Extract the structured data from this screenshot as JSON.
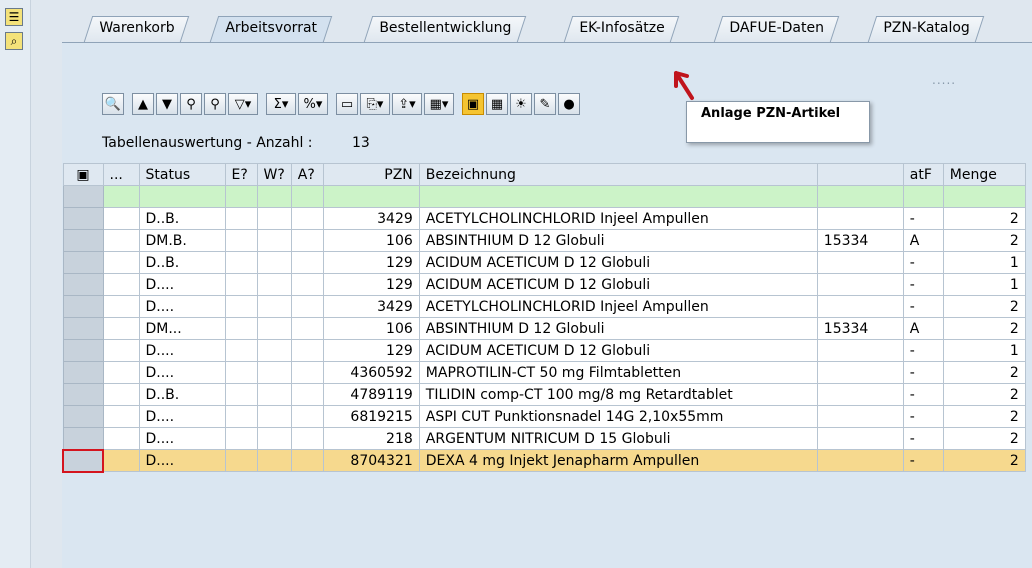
{
  "tabs": [
    "Warenkorb",
    "Arbeitsvorrat",
    "Bestellentwicklung",
    "EK-Infosätze",
    "DAFUE-Daten",
    "PZN-Katalog"
  ],
  "active_tab": "Arbeitsvorrat",
  "toolbar_more": ".....",
  "table_title": "Tabellenauswertung - Anzahl :",
  "table_count": "13",
  "tooltip": "Anlage PZN-Artikel",
  "columns": [
    "...",
    "Status",
    "E?",
    "W?",
    "A?",
    "PZN",
    "Bezeichnung",
    "",
    "atF",
    "Menge"
  ],
  "rows": [
    {
      "status": "D..B.",
      "pzn": "3429",
      "bez": "ACETYLCHOLINCHLORID Injeel Ampullen",
      "col8": "",
      "atf": "-",
      "menge": "2"
    },
    {
      "status": "DM.B.",
      "pzn": "106",
      "bez": "ABSINTHIUM D 12 Globuli",
      "col8": "15334",
      "atf": "A",
      "menge": "2"
    },
    {
      "status": "D..B.",
      "pzn": "129",
      "bez": "ACIDUM ACETICUM D 12 Globuli",
      "col8": "",
      "atf": "-",
      "menge": "1"
    },
    {
      "status": "D....",
      "pzn": "129",
      "bez": "ACIDUM ACETICUM D 12 Globuli",
      "col8": "",
      "atf": "-",
      "menge": "1"
    },
    {
      "status": "D....",
      "pzn": "3429",
      "bez": "ACETYLCHOLINCHLORID Injeel Ampullen",
      "col8": "",
      "atf": "-",
      "menge": "2"
    },
    {
      "status": "DM...",
      "pzn": "106",
      "bez": "ABSINTHIUM D 12 Globuli",
      "col8": "15334",
      "atf": "A",
      "menge": "2"
    },
    {
      "status": "D....",
      "pzn": "129",
      "bez": "ACIDUM ACETICUM D 12 Globuli",
      "col8": "",
      "atf": "-",
      "menge": "1"
    },
    {
      "status": "D....",
      "pzn": "4360592",
      "bez": "MAPROTILIN-CT 50 mg Filmtabletten",
      "col8": "",
      "atf": "-",
      "menge": "2"
    },
    {
      "status": "D..B.",
      "pzn": "4789119",
      "bez": "TILIDIN comp-CT 100 mg/8 mg Retardtablet",
      "col8": "",
      "atf": "-",
      "menge": "2"
    },
    {
      "status": "D....",
      "pzn": "6819215",
      "bez": "ASPI CUT Punktionsnadel 14G 2,10x55mm",
      "col8": "",
      "atf": "-",
      "menge": "2"
    },
    {
      "status": "D....",
      "pzn": "218",
      "bez": "ARGENTUM NITRICUM D 15 Globuli",
      "col8": "",
      "atf": "-",
      "menge": "2"
    },
    {
      "status": "D....",
      "pzn": "8704321",
      "bez": "DEXA 4 mg Injekt Jenapharm Ampullen",
      "col8": "",
      "atf": "-",
      "menge": "2"
    }
  ],
  "selected_row": 11,
  "colors": {
    "filter_row": "#ccf3c8",
    "selected_row": "#f6d98e",
    "highlight_button": "#f5c431",
    "arrow": "#c0141c"
  }
}
